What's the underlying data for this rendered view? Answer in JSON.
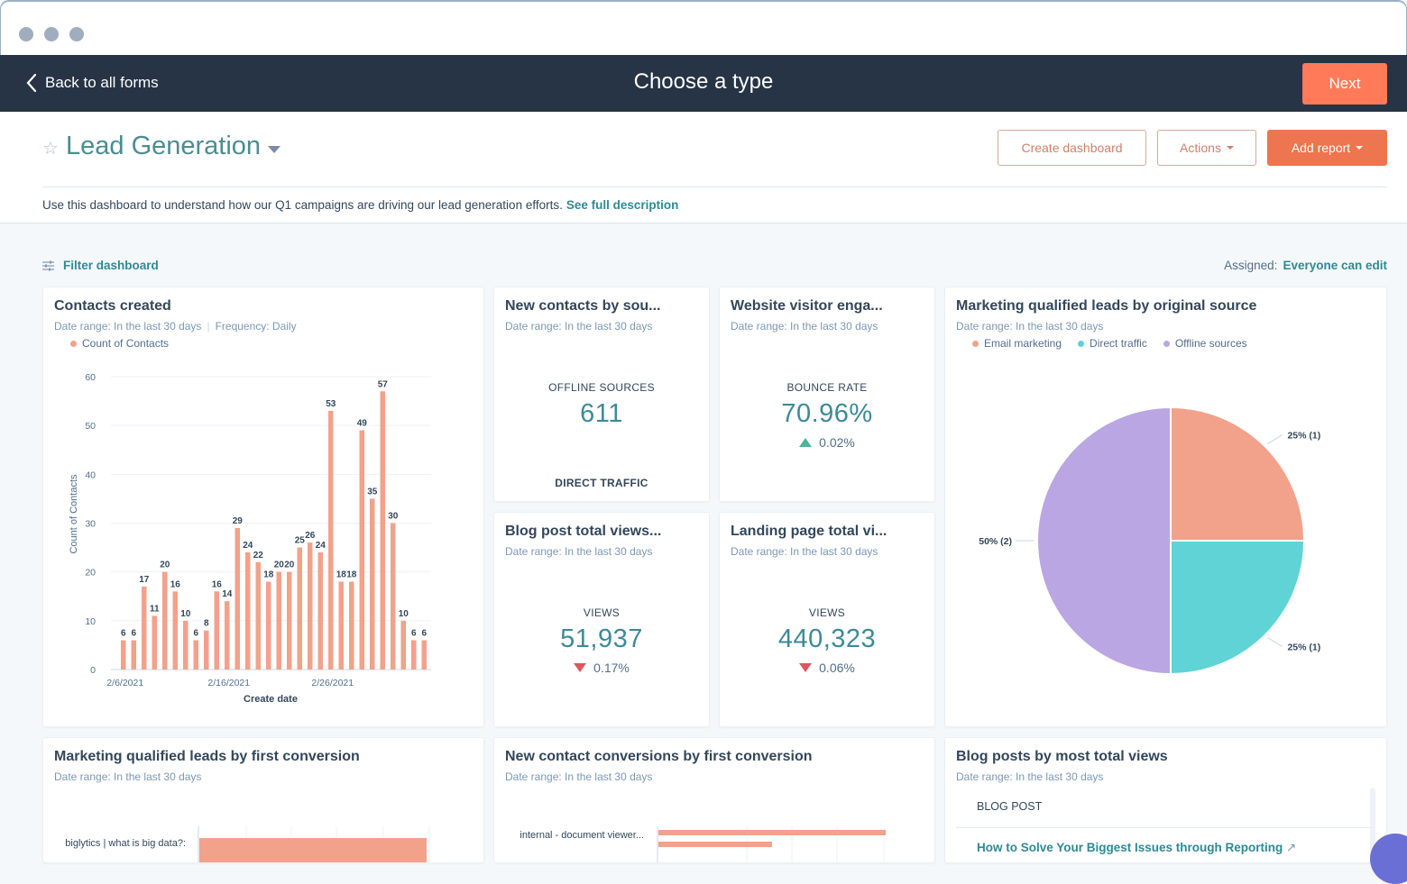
{
  "window": {
    "controls": [
      "close",
      "minimize",
      "maximize"
    ]
  },
  "navbar": {
    "back_label": "Back to all forms",
    "title": "Choose a type",
    "next_label": "Next"
  },
  "header": {
    "dashboard_title": "Lead Generation",
    "create_dashboard_label": "Create dashboard",
    "actions_label": "Actions",
    "add_report_label": "Add report",
    "description": "Use this dashboard to understand how our Q1 campaigns are driving our lead generation efforts.",
    "description_link": "See full description"
  },
  "toolbar": {
    "filter_label": "Filter dashboard",
    "assigned_label": "Assigned:",
    "assigned_value": "Everyone can edit"
  },
  "colors": {
    "accent": "#ff7a59",
    "teal": "#3d8a98",
    "bar": "#f2a18b",
    "email": "#f2a18b",
    "direct": "#5fd3d6",
    "offline": "#bba6e4"
  },
  "cards": {
    "contacts_created": {
      "title": "Contacts created",
      "date_range": "Date range: In the last 30 days",
      "frequency": "Frequency: Daily",
      "legend": "Count of Contacts"
    },
    "new_contacts": {
      "title": "New contacts by sou...",
      "date_range": "Date range: In the last 30 days",
      "label": "OFFLINE SOURCES",
      "value": "611",
      "footer_label": "DIRECT TRAFFIC"
    },
    "website_visitor": {
      "title": "Website visitor enga...",
      "date_range": "Date range: In the last 30 days",
      "label": "BOUNCE RATE",
      "value": "70.96%",
      "change": "0.02%",
      "direction": "up"
    },
    "blog_views": {
      "title": "Blog post total views...",
      "date_range": "Date range: In the last 30 days",
      "label": "VIEWS",
      "value": "51,937",
      "change": "0.17%",
      "direction": "down"
    },
    "landing_views": {
      "title": "Landing page total vi...",
      "date_range": "Date range: In the last 30 days",
      "label": "VIEWS",
      "value": "440,323",
      "change": "0.06%",
      "direction": "down"
    },
    "mql_source": {
      "title": "Marketing qualified leads by original source",
      "date_range": "Date range: In the last 30 days",
      "legend": [
        "Email marketing",
        "Direct traffic",
        "Offline sources"
      ]
    },
    "mql_first_conversion": {
      "title": "Marketing qualified leads by first conversion",
      "date_range": "Date range: In the last 30 days",
      "row_label": "biglytics | what is big data?:"
    },
    "new_contact_conversions": {
      "title": "New contact conversions by first conversion",
      "date_range": "Date range: In the last 30 days",
      "row_label": "internal - document viewer..."
    },
    "blog_posts": {
      "title": "Blog posts by most total views",
      "date_range": "Date range: In the last 30 days",
      "column_header": "BLOG POST",
      "rows": [
        "How to Solve Your Biggest Issues through Reporting"
      ]
    }
  },
  "chart_data": [
    {
      "type": "bar",
      "title": "Contacts created",
      "xlabel": "Create date",
      "ylabel": "Count of Contacts",
      "ylim": [
        0,
        60
      ],
      "yticks": [
        0,
        10,
        20,
        30,
        40,
        50,
        60
      ],
      "xtick_labels": [
        {
          "index": 0,
          "label": "2/6/2021"
        },
        {
          "index": 10,
          "label": "2/16/2021"
        },
        {
          "index": 20,
          "label": "2/26/2021"
        }
      ],
      "grid": true,
      "series": [
        {
          "name": "Count of Contacts",
          "values": [
            6,
            6,
            17,
            11,
            20,
            16,
            10,
            6,
            8,
            16,
            14,
            29,
            24,
            22,
            18,
            20,
            20,
            25,
            26,
            24,
            53,
            18,
            18,
            49,
            35,
            57,
            30,
            10,
            6,
            6
          ]
        }
      ]
    },
    {
      "type": "pie",
      "title": "Marketing qualified leads by original source",
      "slices": [
        {
          "name": "Email marketing",
          "value": 1,
          "percent": 25,
          "label": "25% (1)"
        },
        {
          "name": "Direct traffic",
          "value": 1,
          "percent": 25,
          "label": "25% (1)"
        },
        {
          "name": "Offline sources",
          "value": 2,
          "percent": 50,
          "label": "50% (2)"
        }
      ]
    },
    {
      "type": "bar",
      "orientation": "horizontal",
      "title": "Marketing qualified leads by first conversion",
      "categories": [
        "biglytics | what is big data?:"
      ],
      "values_relative": [
        0.8
      ]
    },
    {
      "type": "bar",
      "orientation": "horizontal",
      "title": "New contact conversions by first conversion",
      "categories": [
        "internal - document viewer..."
      ],
      "values_relative": [
        0.8,
        0.4
      ]
    }
  ]
}
